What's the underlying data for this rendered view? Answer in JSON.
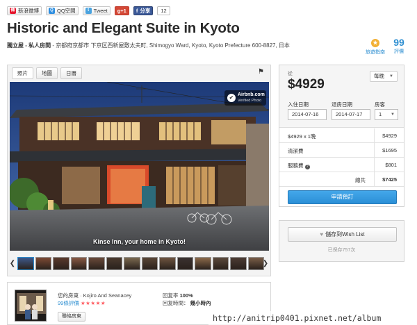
{
  "social": {
    "weibo": "新浪微博",
    "qq": "QQ空間",
    "tweet": "Tweet",
    "gplus": "g+1",
    "fb_share": "分享",
    "fb_count": "12"
  },
  "listing": {
    "title": "Historic and Elegant Suite in Kyoto",
    "room_type": "獨立屋 - 私人房間",
    "address": " - 京都府京都市 下京区西新屋敷太夫町, Shimogyo Ward, Kyoto, Kyoto Prefecture 600-8827, 日本",
    "guide_label": "旅遊指南",
    "review_count": "99",
    "review_label": "評價"
  },
  "photos": {
    "tabs": [
      "照片",
      "地圖",
      "日曆"
    ],
    "badge_brand": "Airbnb.com",
    "badge_sub": "Verified Photo",
    "caption": "Kinse Inn, your home in Kyoto!",
    "thumb_colors": [
      "#3e5a8c",
      "#7d4a34",
      "#5b3a2c",
      "#8a5a44",
      "#6a4a3a",
      "#4a3a2e",
      "#7c6a50",
      "#5a4636",
      "#6e5440",
      "#3a3230",
      "#8c6a4a",
      "#5c4a3c",
      "#4c3c34",
      "#7a5e48"
    ]
  },
  "booking": {
    "from_label": "從",
    "price": "$4929",
    "per_label": "每晚",
    "checkin_label": "入住日期",
    "checkout_label": "退房日期",
    "guests_label": "房客",
    "checkin_value": "2014-07-16",
    "checkout_value": "2014-07-17",
    "guests_value": "1",
    "rows": [
      {
        "label": "$4929 x 1晚",
        "value": "$4929"
      },
      {
        "label": "清潔費",
        "value": "$1695"
      },
      {
        "label": "服務費",
        "value": "$801"
      }
    ],
    "total_label": "總共",
    "total_value": "$7425",
    "book_button": "申請預訂"
  },
  "wishlist": {
    "button": "儲存到Wish List",
    "saved": "已保存757次"
  },
  "host": {
    "label": "您的房東 · Kojiro And Seanacey",
    "reviews": "99條評價",
    "stars": "★★★★★",
    "contact": "聯絡房東",
    "response_rate_label": "回复率",
    "response_rate": "100%",
    "response_time_label": "回复時間：",
    "response_time": "幾小時內"
  },
  "watermark": "http://anitrip0401.pixnet.net/album"
}
